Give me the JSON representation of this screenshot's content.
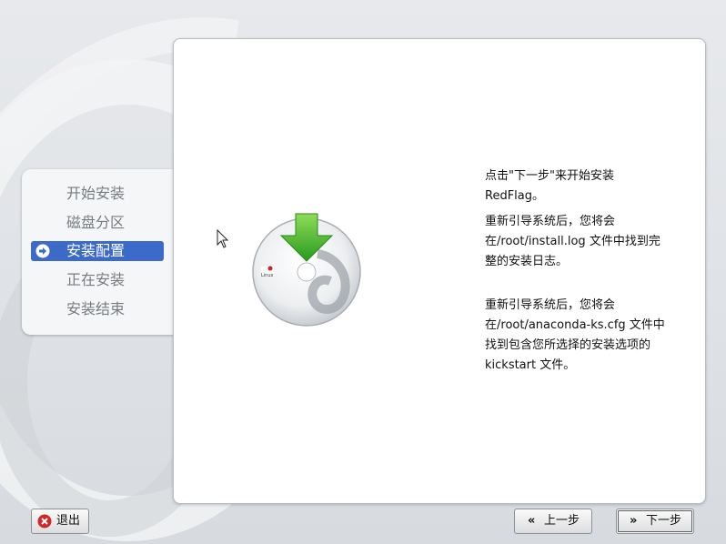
{
  "colors": {
    "accent": "#3b6ac9",
    "quit_icon": "#cc2a2a",
    "arrow_green": "#3fae2a"
  },
  "sidebar": {
    "steps": [
      {
        "label": "开始安装",
        "state": "done"
      },
      {
        "label": "磁盘分区",
        "state": "done"
      },
      {
        "label": "安装配置",
        "state": "current"
      },
      {
        "label": "正在安装",
        "state": "pending"
      },
      {
        "label": "安装结束",
        "state": "pending"
      }
    ]
  },
  "main": {
    "logo_text": "Linux",
    "paragraphs": [
      "点击\"下一步\"来开始安装RedFlag。",
      "重新引导系统后，您将会在/root/install.log 文件中找到完整的安装日志。",
      "重新引导系统后，您将会在/root/anaconda-ks.cfg 文件中找到包含您所选择的安装选项的 kickstart 文件。"
    ]
  },
  "buttons": {
    "quit": "退出",
    "back": "上一步",
    "next": "下一步",
    "back_chevron": "«",
    "next_chevron": "»"
  },
  "icons": {
    "quit": "close-circle-icon",
    "current_step": "arrow-circle-icon",
    "disc": "install-disc-icon",
    "cursor": "mouse-pointer-icon"
  }
}
